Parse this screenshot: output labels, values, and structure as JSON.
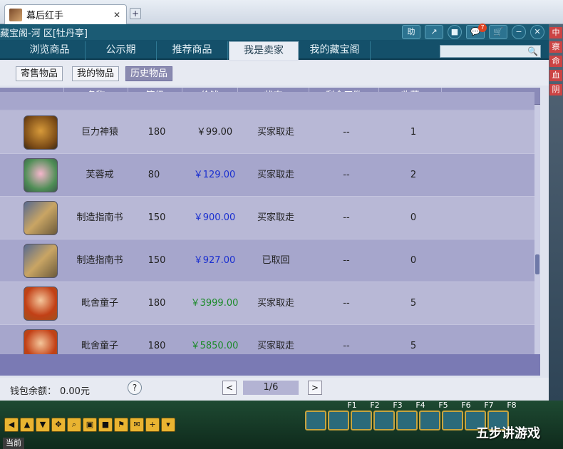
{
  "browser": {
    "tab_title": "幕后红手",
    "tab_close": "✕",
    "new_tab": "+"
  },
  "window": {
    "title": "藏宝阁-河 区[牡丹亭]",
    "buttons": [
      "助",
      "↗",
      "■",
      "💬",
      "🛒",
      "−",
      "✕"
    ],
    "notification_count": "7"
  },
  "nav": {
    "tabs": [
      "浏览商品",
      "公示期",
      "推荐商品",
      "我是卖家",
      "我的藏宝阁"
    ],
    "active": "我是卖家",
    "search_placeholder": ""
  },
  "subtabs": {
    "items": [
      "寄售物品",
      "我的物品",
      "历史物品"
    ],
    "active": "历史物品"
  },
  "table": {
    "headers": [
      "名称",
      "等级",
      "价钱",
      "状态",
      "剩余天数",
      "收藏"
    ],
    "rows": [
      {
        "name": "巨力神猿",
        "level": "180",
        "price": "￥99.00",
        "price_color": "black",
        "status": "买家取走",
        "days": "--",
        "fav": "1",
        "icon": "ape"
      },
      {
        "name": "芙蓉戒",
        "level": "80",
        "price": "￥129.00",
        "price_color": "blue",
        "status": "买家取走",
        "days": "--",
        "fav": "2",
        "icon": "lotus"
      },
      {
        "name": "制造指南书",
        "level": "150",
        "price": "￥900.00",
        "price_color": "blue",
        "status": "买家取走",
        "days": "--",
        "fav": "0",
        "icon": "scroll"
      },
      {
        "name": "制造指南书",
        "level": "150",
        "price": "￥927.00",
        "price_color": "blue",
        "status": "已取回",
        "days": "--",
        "fav": "0",
        "icon": "scroll"
      },
      {
        "name": "毗舍童子",
        "level": "180",
        "price": "￥3999.00",
        "price_color": "green",
        "status": "买家取走",
        "days": "--",
        "fav": "5",
        "icon": "boy"
      },
      {
        "name": "毗舍童子",
        "level": "180",
        "price": "￥5850.00",
        "price_color": "green",
        "status": "买家取走",
        "days": "--",
        "fav": "5",
        "icon": "boy"
      }
    ]
  },
  "status": {
    "wallet_label": "钱包余额：",
    "wallet_value": "0.00元",
    "help": "?",
    "page_prev": "<",
    "page_indicator": "1/6",
    "page_next": ">"
  },
  "game": {
    "fkeys": [
      "F1",
      "F2",
      "F3",
      "F4",
      "F5",
      "F6",
      "F7",
      "F8"
    ],
    "watermark": "五步讲游戏",
    "current_tab": "当前",
    "side_marks": [
      "中",
      "察",
      "命",
      "血",
      "阴"
    ]
  },
  "colors": {
    "nav_bg": "#14506a",
    "table_header_bg": "#8a8ab8",
    "price_blue": "#1a2fd0",
    "price_green": "#1c8a2a"
  }
}
